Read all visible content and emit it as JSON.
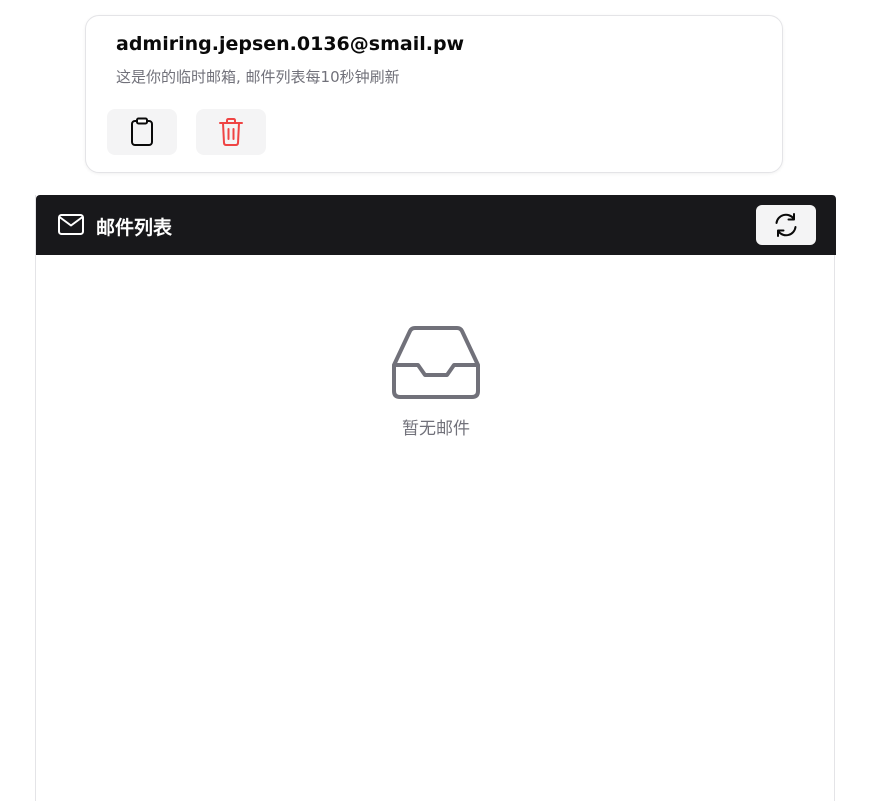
{
  "address_card": {
    "email": "admiring.jepsen.0136@smail.pw",
    "hint": "这是你的临时邮箱, 邮件列表每10秒钟刷新",
    "copy_icon": "clipboard-icon",
    "delete_icon": "trash-icon"
  },
  "mail_list": {
    "title": "邮件列表",
    "header_icon": "mail-icon",
    "refresh_icon": "refresh-icon",
    "empty_icon": "inbox-icon",
    "empty_text": "暂无邮件"
  },
  "colors": {
    "header_bg": "#18181b",
    "delete_accent": "#ef4444",
    "muted_text": "#71717a",
    "button_bg": "#f4f4f5"
  }
}
